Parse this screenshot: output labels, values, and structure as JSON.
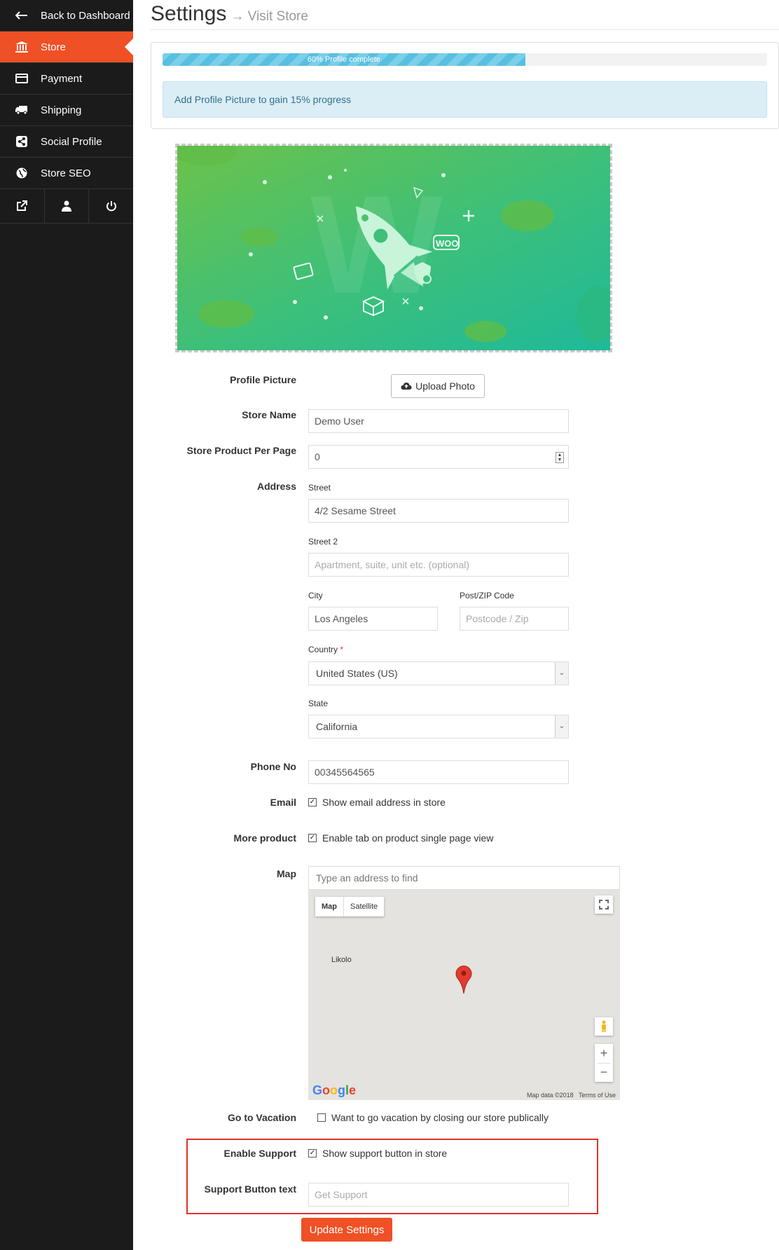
{
  "sidebar": {
    "items": [
      {
        "label": "Back to Dashboard",
        "icon": "arrow-left-icon"
      },
      {
        "label": "Store",
        "icon": "bank-icon"
      },
      {
        "label": "Payment",
        "icon": "credit-card-icon"
      },
      {
        "label": "Shipping",
        "icon": "truck-icon"
      },
      {
        "label": "Social Profile",
        "icon": "share-icon"
      },
      {
        "label": "Store SEO",
        "icon": "globe-icon"
      }
    ],
    "bottom_icons": [
      "external-link-icon",
      "user-icon",
      "power-icon"
    ],
    "active_color": "#f05025"
  },
  "header": {
    "title": "Settings",
    "visit_store": "→ Visit Store"
  },
  "progress": {
    "value_percent": 60,
    "label": "60% Profile complete",
    "alert": "Add Profile Picture to gain 15% progress"
  },
  "banner": {
    "logo_text": "WOO"
  },
  "form": {
    "profile_picture": {
      "label": "Profile Picture",
      "button": "Upload Photo"
    },
    "store_name": {
      "label": "Store Name",
      "value": "Demo User"
    },
    "per_page": {
      "label": "Store Product Per Page",
      "value": "0"
    },
    "address": {
      "label": "Address",
      "street_label": "Street",
      "street_value": "4/2 Sesame Street",
      "street2_label": "Street 2",
      "street2_placeholder": "Apartment, suite, unit etc. (optional)",
      "city_label": "City",
      "city_value": "Los Angeles",
      "zip_label": "Post/ZIP Code",
      "zip_placeholder": "Postcode / Zip",
      "country_label": "Country",
      "required_mark": "*",
      "country_value": "United States (US)",
      "state_label": "State",
      "state_value": "California"
    },
    "phone": {
      "label": "Phone No",
      "value": "00345564565"
    },
    "email": {
      "label": "Email",
      "checkbox_text": "Show email address in store",
      "checked": true
    },
    "more_product": {
      "label": "More product",
      "checkbox_text": "Enable tab on product single page view",
      "checked": true
    },
    "map": {
      "label": "Map",
      "search_placeholder": "Type an address to find",
      "type_map": "Map",
      "type_satellite": "Satellite",
      "place_label": "Likolo",
      "logo": "Google",
      "map_data": "Map data ©2018",
      "terms": "Terms of Use"
    },
    "vacation": {
      "label": "Go to Vacation",
      "checkbox_text": "Want to go vacation by closing our store publically",
      "checked": false
    },
    "support": {
      "label": "Enable Support",
      "checkbox_text": "Show support button in store",
      "checked": true
    },
    "support_text": {
      "label": "Support Button text",
      "placeholder": "Get Support"
    },
    "submit": "Update Settings"
  }
}
